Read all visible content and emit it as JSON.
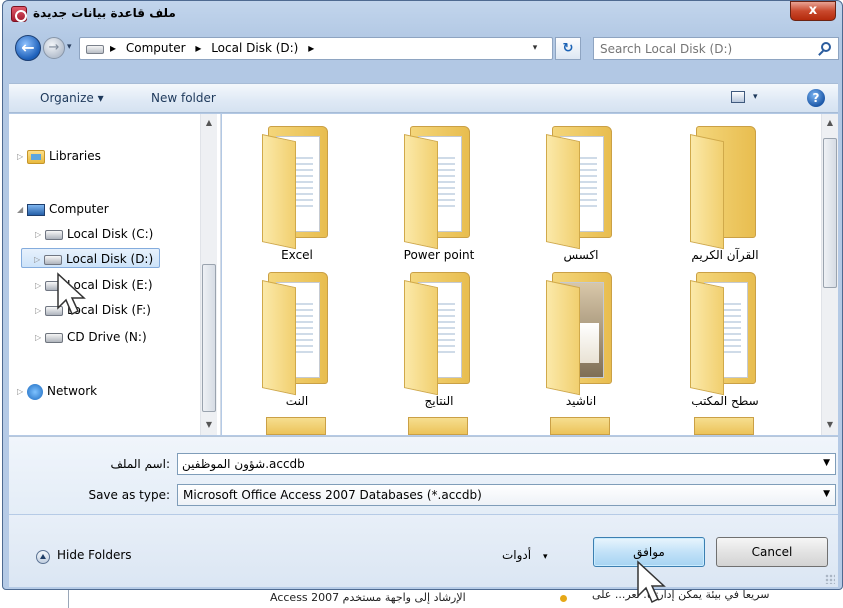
{
  "window": {
    "title": "ملف قاعدة بيانات جديدة",
    "close_label": "x"
  },
  "address_bar": {
    "crumbs": [
      "▸",
      "Computer",
      "▸",
      "Local Disk (D:)",
      "▸"
    ],
    "dropdown": "▾"
  },
  "search": {
    "placeholder": "Search Local Disk (D:)"
  },
  "toolbar": {
    "organize_label": "Organize ▾",
    "new_folder_label": "New folder",
    "view_dropdown": "▾",
    "help_label": "?"
  },
  "nav_pane": {
    "items": [
      {
        "label": "Libraries",
        "icon": "libraries-icon",
        "arrow": "▷"
      },
      {
        "label": "Computer",
        "icon": "computer-icon",
        "arrow": "◢"
      },
      {
        "label": "Local Disk (C:)",
        "icon": "drive-icon",
        "arrow": "▷"
      },
      {
        "label": "Local Disk (D:)",
        "icon": "drive-icon",
        "arrow": "▷",
        "selected": true
      },
      {
        "label": "Local Disk (E:)",
        "icon": "drive-icon",
        "arrow": "▷"
      },
      {
        "label": "Local Disk (F:)",
        "icon": "drive-icon",
        "arrow": "▷"
      },
      {
        "label": "CD Drive (N:)",
        "icon": "cd-drive-icon",
        "arrow": "▷"
      },
      {
        "label": "Network",
        "icon": "network-icon",
        "arrow": "▷"
      }
    ]
  },
  "folders": [
    {
      "name": "Excel"
    },
    {
      "name": "Power point"
    },
    {
      "name": "اكسس"
    },
    {
      "name": "القرآن الكريم"
    },
    {
      "name": "النت"
    },
    {
      "name": "النتايج"
    },
    {
      "name": "اناشيد"
    },
    {
      "name": "سطح المكتب"
    }
  ],
  "form": {
    "filename_label": "اسم الملف:",
    "filename_value": "شؤون الموظفين.accdb",
    "savetype_label": "Save as type:",
    "savetype_value": "Microsoft Office Access 2007 Databases (*.accdb)"
  },
  "footer": {
    "hide_folders_label": "Hide Folders",
    "tools_label": "أدوات",
    "tools_arrow": "▾",
    "ok_label": "موافق",
    "cancel_label": "Cancel"
  },
  "background_doc": {
    "line1": "الإرشاد إلى واجهة مستخدم Access 2007",
    "line2": "سريعا في بيئة يمكن إدارتها. تعر... على"
  }
}
